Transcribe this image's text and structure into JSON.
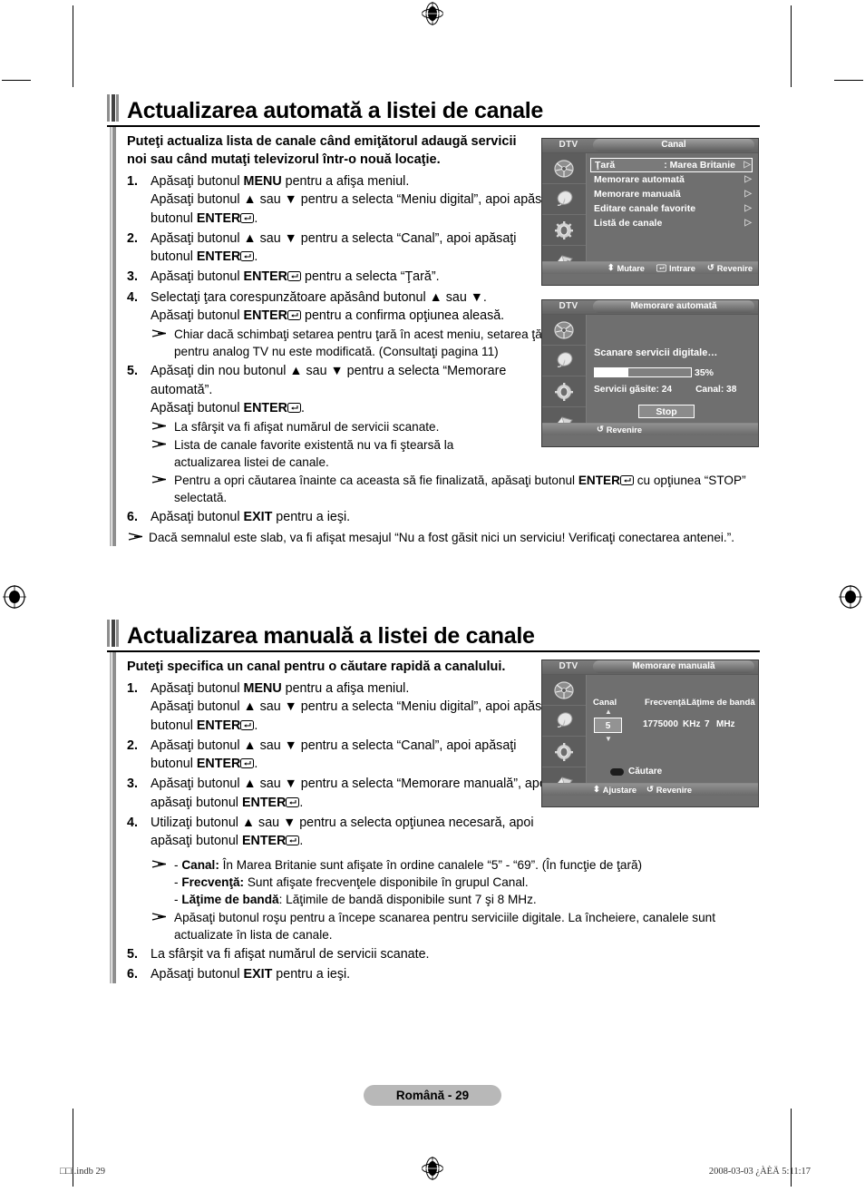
{
  "page": {
    "footer_badge": "Română - 29",
    "print_left": "□□i.indb  29",
    "print_right": "2008-03-03   ¿ÀÈÄ 5:11:17"
  },
  "sections": [
    {
      "id": "auto-update",
      "title": "Actualizarea automată a listei de canale",
      "lead": "Puteţi actualiza lista de canale când emiţătorul adaugă servicii noi sau când mutaţi televizorul într-o nouă locaţie.",
      "steps": [
        {
          "num": "1.",
          "lines": [
            "Apăsaţi butonul MENU pentru a afişa meniul.",
            "Apăsaţi butonul ▲ sau ▼ pentru a selecta “Meniu digital”, apoi apăsaţi butonul ENTER⏎."
          ]
        },
        {
          "num": "2.",
          "lines": [
            "Apăsaţi butonul ▲ sau ▼ pentru a selecta “Canal”, apoi apăsaţi butonul ENTER⏎."
          ]
        },
        {
          "num": "3.",
          "lines": [
            "Apăsaţi butonul ENTER⏎ pentru a selecta “Ţară”."
          ]
        },
        {
          "num": "4.",
          "lines": [
            "Selectaţi ţara corespunzătoare apăsând butonul ▲ sau ▼.",
            "Apăsaţi butonul ENTER⏎ pentru a confirma opţiunea aleasă."
          ],
          "notes": [
            "Chiar dacă schimbaţi setarea pentru ţară în acest meniu, setarea ţării pentru analog TV nu este modificată. (Consultaţi pagina 11)"
          ]
        },
        {
          "num": "5.",
          "lines": [
            "Apăsaţi din nou butonul ▲ sau ▼ pentru a selecta “Memorare automată”.",
            "Apăsaţi butonul ENTER⏎."
          ],
          "notes": [
            "La sfârşit va fi afişat numărul de servicii scanate.",
            "Lista de canale favorite existentă nu va fi ştearsă la actualizarea listei de canale.",
            "Pentru a opri căutarea înainte ca aceasta să fie finalizată, apăsaţi butonul ENTER⏎ cu opţiunea “STOP” selectată."
          ]
        },
        {
          "num": "6.",
          "lines": [
            "Apăsaţi butonul EXIT pentru a ieşi."
          ]
        }
      ],
      "tail_note": "Dacă semnalul este slab, va fi afişat mesajul “Nu a fost găsit nici un serviciu! Verificaţi conectarea antenei.”."
    },
    {
      "id": "manual-update",
      "title": "Actualizarea manuală a listei de canale",
      "lead": "Puteţi specifica un canal pentru o căutare rapidă a canalului.",
      "steps": [
        {
          "num": "1.",
          "lines": [
            "Apăsaţi butonul MENU pentru a afişa meniul.",
            "Apăsaţi butonul ▲ sau ▼ pentru a selecta “Meniu digital”, apoi apăsaţi butonul ENTER⏎."
          ]
        },
        {
          "num": "2.",
          "lines": [
            "Apăsaţi butonul ▲ sau ▼ pentru a selecta “Canal”, apoi apăsaţi butonul ENTER⏎."
          ]
        },
        {
          "num": "3.",
          "lines": [
            "Apăsaţi butonul ▲ sau ▼ pentru a selecta “Memorare manuală”, apoi apăsaţi butonul ENTER⏎."
          ]
        },
        {
          "num": "4.",
          "lines": [
            "Utilizaţi butonul ▲ sau ▼ pentru a selecta opţiunea necesară, apoi apăsaţi butonul ENTER⏎."
          ],
          "notes": [
            "- Canal: În Marea Britanie sunt afişate în ordine canalele “5” - “69”. (În funcţie de ţară)|- Frecvenţă: Sunt afişate frecvenţele disponibile în grupul Canal.|- Lăţime de bandă: Lăţimile de bandă disponibile sunt 7 şi 8 MHz.",
            "Apăsaţi butonul roşu pentru a începe scanarea pentru serviciile digitale. La încheiere, canalele sunt actualizate în lista de canale."
          ]
        },
        {
          "num": "5.",
          "lines": [
            "La sfârşit va fi afişat numărul de servicii scanate."
          ]
        },
        {
          "num": "6.",
          "lines": [
            "Apăsaţi butonul EXIT pentru a ieşi."
          ]
        }
      ]
    }
  ],
  "osd": {
    "channel_menu": {
      "source_label": "DTV",
      "title": "Canal",
      "items": [
        {
          "label": "Ţară",
          "value": ": Marea Britanie",
          "selected": true
        },
        {
          "label": "Memorare automată",
          "value": "",
          "selected": false
        },
        {
          "label": "Memorare manuală",
          "value": "",
          "selected": false
        },
        {
          "label": "Editare canale favorite",
          "value": "",
          "selected": false
        },
        {
          "label": "Listă de canale",
          "value": "",
          "selected": false
        }
      ],
      "hints": [
        {
          "icon": "updown-arrow-icon",
          "label": "Mutare"
        },
        {
          "icon": "enter-icon",
          "label": "Intrare"
        },
        {
          "icon": "return-icon",
          "label": "Revenire"
        }
      ]
    },
    "auto_store": {
      "source_label": "DTV",
      "title": "Memorare automată",
      "scan_label": "Scanare servicii digitale…",
      "progress_percent": 35,
      "progress_text": "35%",
      "services_found_label": "Servicii găsite: 24",
      "channel_label": "Canal: 38",
      "stop_button": "Stop",
      "hints": [
        {
          "icon": "return-icon",
          "label": "Revenire"
        }
      ]
    },
    "manual_store": {
      "source_label": "DTV",
      "title": "Memorare manuală",
      "headers": {
        "channel": "Canal",
        "frequency": "Frecvenţă",
        "bandwidth": "Lăţime de bandă"
      },
      "values": {
        "channel": "5",
        "frequency": "1775000",
        "frequency_unit": "KHz",
        "bandwidth": "7",
        "bandwidth_unit": "MHz"
      },
      "search_label": "Căutare",
      "hints": [
        {
          "icon": "updown-arrow-icon",
          "label": "Ajustare"
        },
        {
          "icon": "return-icon",
          "label": "Revenire"
        }
      ]
    }
  }
}
